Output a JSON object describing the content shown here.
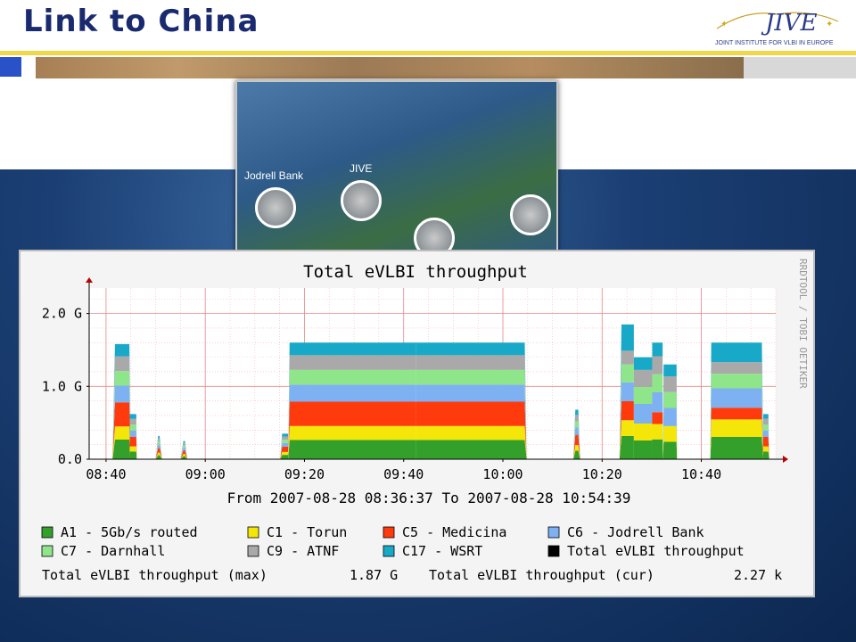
{
  "slide": {
    "title": "Link to China"
  },
  "logo": {
    "name": "JIVE",
    "subtitle": "JOINT INSTITUTE FOR VLBI IN EUROPE",
    "icon": "jive-logo-icon"
  },
  "map": {
    "sites": [
      "Jodrell Bank",
      "JIVE"
    ]
  },
  "chart_data": {
    "type": "area",
    "title": "Total eVLBI throughput",
    "side_label": "RRDTOOL / TOBI OETIKER",
    "period": "From 2007-08-28 08:36:37 To 2007-08-28 10:54:39",
    "xlabel": "",
    "ylabel": "",
    "ylim": [
      0,
      2.35
    ],
    "y_ticks": [
      {
        "v": 0,
        "label": "0.0"
      },
      {
        "v": 1.0,
        "label": "1.0 G"
      },
      {
        "v": 2.0,
        "label": "2.0 G"
      }
    ],
    "x_ticks": [
      "08:40",
      "09:00",
      "09:20",
      "09:40",
      "10:00",
      "10:20",
      "10:40"
    ],
    "x_tick_minutes": [
      520,
      540,
      560,
      580,
      600,
      620,
      640
    ],
    "xlim": [
      516.6,
      655
    ],
    "grid": true,
    "segments": [
      {
        "start": 521.3,
        "end": 525.0,
        "up": 521.8,
        "down": 524.7,
        "tot": 1.58,
        "sh": [
          0.27,
          0.18,
          0.33,
          0.23,
          0.2,
          0.2,
          0.17
        ]
      },
      {
        "start": 524.7,
        "end": 526.2,
        "up": 524.8,
        "down": 526.1,
        "tot": 0.62,
        "sh": [
          0.27,
          0.18,
          0.33,
          0.23,
          0.2,
          0.2,
          0.17
        ]
      },
      {
        "start": 530.0,
        "end": 531.3,
        "up": 530.5,
        "down": 530.8,
        "tot": 0.32,
        "sh": [
          0.27,
          0.18,
          0.33,
          0.23,
          0.2,
          0.2,
          0.17
        ]
      },
      {
        "start": 535.0,
        "end": 536.4,
        "up": 535.6,
        "down": 535.9,
        "tot": 0.25,
        "sh": [
          0.27,
          0.18,
          0.33,
          0.23,
          0.2,
          0.2,
          0.17
        ]
      },
      {
        "start": 555.1,
        "end": 556.7,
        "up": 555.5,
        "down": 556.7,
        "tot": 0.35,
        "sh": [
          0.27,
          0.18,
          0.33,
          0.23,
          0.2,
          0.2,
          0.17
        ]
      },
      {
        "start": 556.7,
        "end": 582.5,
        "up": 557.0,
        "down": 582.5,
        "tot": 1.6,
        "sh": [
          0.26,
          0.19,
          0.33,
          0.23,
          0.2,
          0.2,
          0.17
        ]
      },
      {
        "start": 582.5,
        "end": 604.8,
        "up": 582.5,
        "down": 604.4,
        "tot": 1.6,
        "sh": [
          0.26,
          0.19,
          0.33,
          0.23,
          0.2,
          0.2,
          0.17
        ]
      },
      {
        "start": 614.2,
        "end": 615.6,
        "up": 614.6,
        "down": 615.2,
        "tot": 0.68,
        "sh": [
          0.27,
          0.18,
          0.33,
          0.23,
          0.2,
          0.2,
          0.17
        ]
      },
      {
        "start": 623.5,
        "end": 626.4,
        "up": 623.9,
        "down": 626.4,
        "tot": 1.85,
        "sh": [
          0.22,
          0.15,
          0.18,
          0.18,
          0.17,
          0.13,
          0.25
        ]
      },
      {
        "start": 626.4,
        "end": 630.1,
        "up": 626.4,
        "down": 630.1,
        "tot": 1.4,
        "sh": [
          0.22,
          0.2,
          0.0,
          0.23,
          0.2,
          0.2,
          0.15
        ]
      },
      {
        "start": 630.1,
        "end": 632.2,
        "up": 630.1,
        "down": 632.2,
        "tot": 1.6,
        "sh": [
          0.22,
          0.17,
          0.13,
          0.22,
          0.2,
          0.2,
          0.15
        ]
      },
      {
        "start": 632.2,
        "end": 635.1,
        "up": 632.4,
        "down": 635.0,
        "tot": 1.3,
        "sh": [
          0.22,
          0.2,
          0.0,
          0.23,
          0.2,
          0.2,
          0.15
        ]
      },
      {
        "start": 641.8,
        "end": 652.5,
        "up": 642.0,
        "down": 652.2,
        "tot": 1.6,
        "sh": [
          0.23,
          0.18,
          0.12,
          0.2,
          0.15,
          0.12,
          0.2
        ]
      },
      {
        "start": 652.3,
        "end": 653.7,
        "up": 652.5,
        "down": 653.5,
        "tot": 0.62,
        "sh": [
          0.27,
          0.18,
          0.33,
          0.23,
          0.2,
          0.2,
          0.17
        ]
      }
    ],
    "series": [
      {
        "name": "A1 - 5Gb/s routed",
        "color": "#33a02c"
      },
      {
        "name": "C1 - Torun",
        "color": "#f5e60a"
      },
      {
        "name": "C5 - Medicina",
        "color": "#ff3a0c"
      },
      {
        "name": "C6 - Jodrell Bank",
        "color": "#7eb1f2"
      },
      {
        "name": "C7 - Darnhall",
        "color": "#8fe58a"
      },
      {
        "name": "C9 - ATNF",
        "color": "#a9a9a9"
      },
      {
        "name": "C17 - WSRT",
        "color": "#19a9c8"
      },
      {
        "name": "Total eVLBI throughput",
        "color": "#000000"
      }
    ],
    "stats": {
      "max_label": "Total eVLBI throughput (max)",
      "max_value": "1.87 G",
      "cur_label": "Total eVLBI throughput (cur)",
      "cur_value": "2.27 k"
    }
  }
}
